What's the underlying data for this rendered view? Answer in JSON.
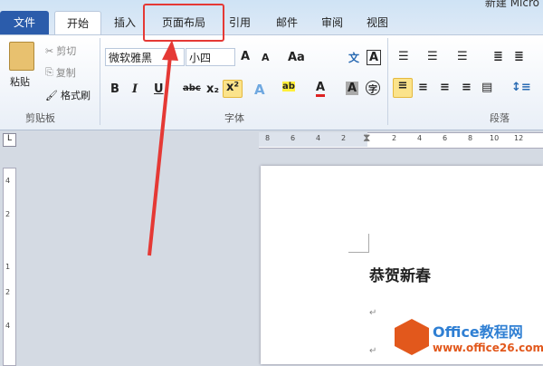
{
  "window": {
    "title": "新建 Micro"
  },
  "tabs": [
    "文件",
    "开始",
    "插入",
    "页面布局",
    "引用",
    "邮件",
    "审阅",
    "视图"
  ],
  "clipboard": {
    "paste": "粘贴",
    "cut": "剪切",
    "copy": "复制",
    "format_painter": "格式刷",
    "label": "剪贴板"
  },
  "font": {
    "name": "微软雅黑",
    "size": "小四",
    "grow": "A",
    "shrink": "A",
    "case": "Aa",
    "bold": "B",
    "italic": "I",
    "underline": "U",
    "strike": "abc",
    "subscript": "x₂",
    "superscript": "x²",
    "label": "字体",
    "phonetic": "文",
    "border": "A",
    "color": "A",
    "shade": "A",
    "enclose": "字"
  },
  "paragraph": {
    "label": "段落"
  },
  "ruler": {
    "ticks": [
      "8",
      "6",
      "4",
      "2",
      "2",
      "4",
      "6",
      "8",
      "10",
      "12"
    ],
    "vticks": [
      "4",
      "2",
      "1",
      "2",
      "4"
    ]
  },
  "document": {
    "heading": "恭贺新春",
    "para_mark": "↵"
  },
  "watermark": {
    "brand": "Office教程网",
    "url": "www.office26.com"
  }
}
